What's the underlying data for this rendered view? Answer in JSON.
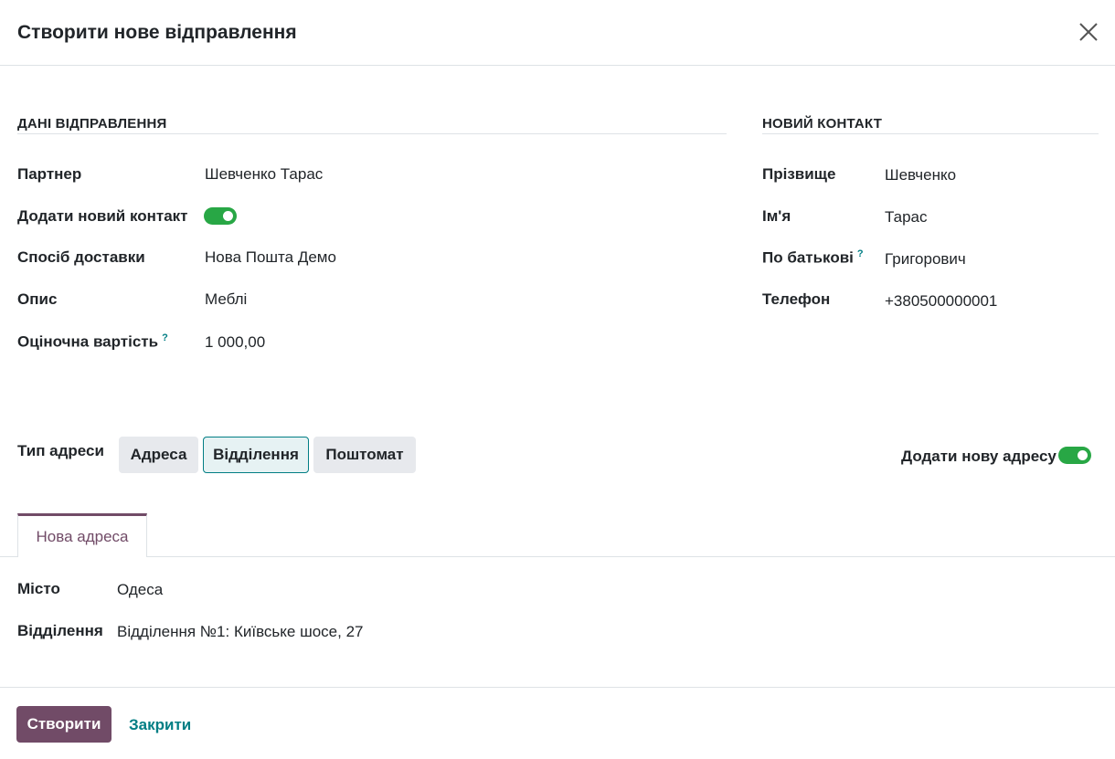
{
  "dialog": {
    "title": "Створити нове відправлення"
  },
  "shipment": {
    "section_title": "ДАНІ ВІДПРАВЛЕННЯ",
    "fields": {
      "partner": {
        "label": "Партнер",
        "value": "Шевченко Тарас"
      },
      "add_contact": {
        "label": "Додати новий контакт",
        "enabled": true
      },
      "delivery": {
        "label": "Спосіб доставки",
        "value": "Нова Пошта Демо"
      },
      "description": {
        "label": "Опис",
        "value": "Меблі"
      },
      "value": {
        "label": "Оціночна вартість",
        "help": "?",
        "value": "1 000,00"
      }
    }
  },
  "contact": {
    "section_title": "НОВИЙ КОНТАКТ",
    "fields": {
      "last_name": {
        "label": "Прізвище",
        "value": "Шевченко"
      },
      "first_name": {
        "label": "Ім'я",
        "value": "Тарас"
      },
      "middle_name": {
        "label": "По батькові",
        "help": "?",
        "value": "Григорович"
      },
      "phone": {
        "label": "Телефон",
        "value": "+380500000001"
      }
    }
  },
  "address_type": {
    "label": "Тип адреси",
    "options": [
      "Адреса",
      "Відділення",
      "Поштомат"
    ],
    "selected": "Відділення"
  },
  "add_address": {
    "label": "Додати нову адресу",
    "enabled": true
  },
  "tab": {
    "label": "Нова адреса"
  },
  "address": {
    "city": {
      "label": "Місто",
      "value": "Одеса"
    },
    "branch": {
      "label": "Відділення",
      "value": "Відділення №1: Київське шосе, 27"
    }
  },
  "footer": {
    "create": "Створити",
    "close": "Закрити"
  },
  "colors": {
    "primary": "#714b67",
    "accent": "#017e84",
    "toggle_on": "#28a745"
  }
}
